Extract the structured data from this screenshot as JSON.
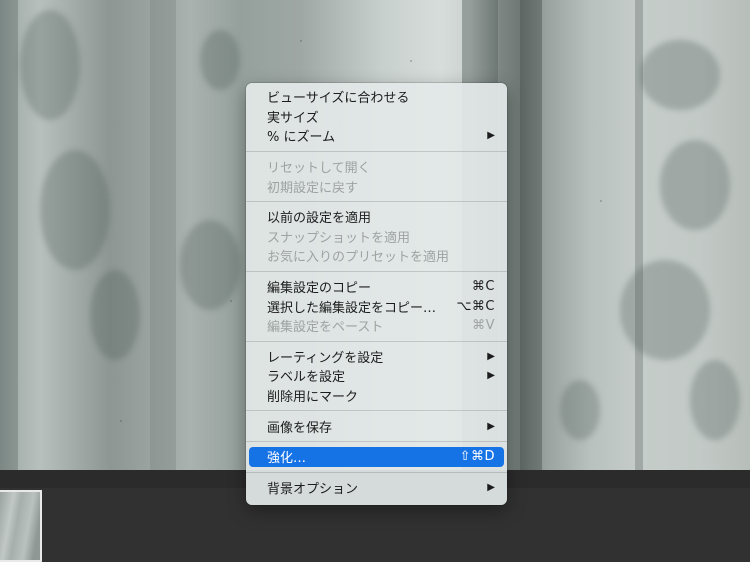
{
  "menu": {
    "fit_view": "ビューサイズに合わせる",
    "actual_size": "実サイズ",
    "zoom_percent": "% にズーム",
    "reset_open": "リセットして開く",
    "reset_default": "初期設定に戻す",
    "apply_previous": "以前の設定を適用",
    "apply_snapshot": "スナップショットを適用",
    "apply_favorite_preset": "お気に入りのプリセットを適用",
    "copy_edits": "編集設定のコピー",
    "copy_edits_shortcut": "⌘C",
    "copy_selected_edits": "選択した編集設定をコピー…",
    "copy_selected_edits_shortcut": "⌥⌘C",
    "paste_edits": "編集設定をペースト",
    "paste_edits_shortcut": "⌘V",
    "set_rating": "レーティングを設定",
    "set_label": "ラベルを設定",
    "mark_for_deletion": "削除用にマーク",
    "save_image": "画像を保存",
    "enhance": "強化…",
    "enhance_shortcut": "⇧⌘D",
    "background_options": "背景オプション",
    "submenu_arrow": "▶"
  },
  "colors": {
    "menu_bg": "#e2e8e7",
    "highlight": "#1673e6",
    "text": "#1c1c1c",
    "disabled_text": "#9ea3a2",
    "filmstrip": "#313131"
  },
  "icons": [
    "chevron-right-icon"
  ]
}
